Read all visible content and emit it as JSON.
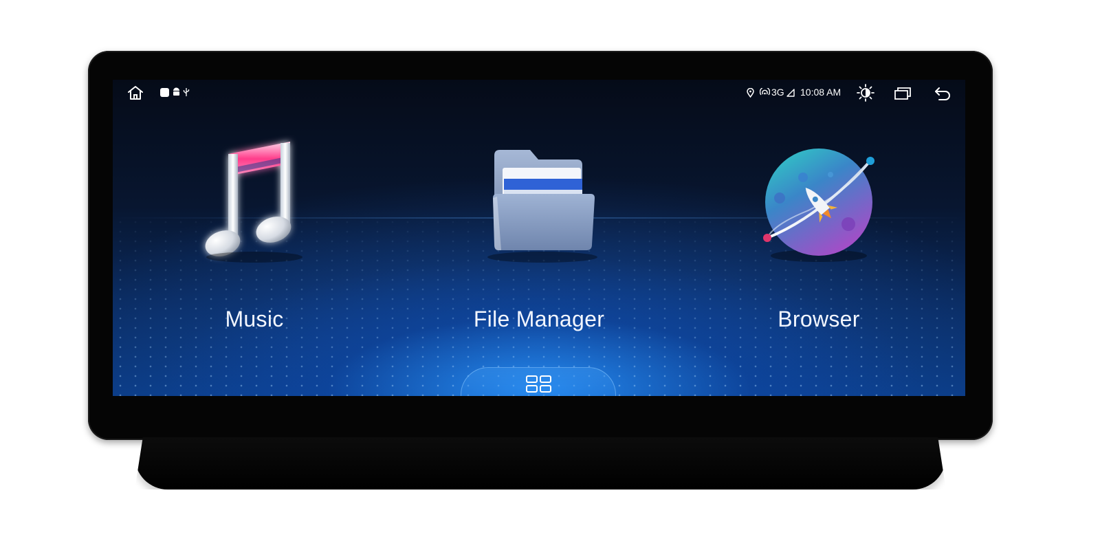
{
  "status_bar": {
    "time": "10:08 AM",
    "network": "3G",
    "icons": [
      "home-icon",
      "notification-square-icon",
      "android-icon",
      "usb-icon",
      "location-icon",
      "hotspot-icon",
      "signal-icon",
      "brightness-icon",
      "recent-apps-icon",
      "back-icon"
    ]
  },
  "apps": [
    {
      "label": "Music",
      "icon": "music-note-icon",
      "accent": "#ff3d8b"
    },
    {
      "label": "File Manager",
      "icon": "folder-icon",
      "accent": "#7d97c2"
    },
    {
      "label": "Browser",
      "icon": "planet-rocket-icon",
      "accent": "#2ec8c8"
    }
  ],
  "drawer": {
    "icon": "app-grid-icon"
  },
  "colors": {
    "screen_bg": "#081630",
    "floor_glow": "#2896ff",
    "text": "#ffffff"
  }
}
